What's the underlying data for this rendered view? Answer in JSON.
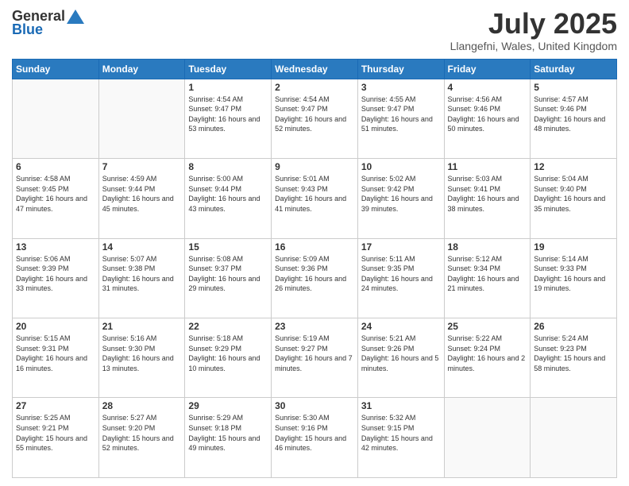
{
  "logo": {
    "general": "General",
    "blue": "Blue"
  },
  "header": {
    "month": "July 2025",
    "location": "Llangefni, Wales, United Kingdom"
  },
  "days_of_week": [
    "Sunday",
    "Monday",
    "Tuesday",
    "Wednesday",
    "Thursday",
    "Friday",
    "Saturday"
  ],
  "weeks": [
    [
      {
        "day": "",
        "sunrise": "",
        "sunset": "",
        "daylight": ""
      },
      {
        "day": "",
        "sunrise": "",
        "sunset": "",
        "daylight": ""
      },
      {
        "day": "1",
        "sunrise": "Sunrise: 4:54 AM",
        "sunset": "Sunset: 9:47 PM",
        "daylight": "Daylight: 16 hours and 53 minutes."
      },
      {
        "day": "2",
        "sunrise": "Sunrise: 4:54 AM",
        "sunset": "Sunset: 9:47 PM",
        "daylight": "Daylight: 16 hours and 52 minutes."
      },
      {
        "day": "3",
        "sunrise": "Sunrise: 4:55 AM",
        "sunset": "Sunset: 9:47 PM",
        "daylight": "Daylight: 16 hours and 51 minutes."
      },
      {
        "day": "4",
        "sunrise": "Sunrise: 4:56 AM",
        "sunset": "Sunset: 9:46 PM",
        "daylight": "Daylight: 16 hours and 50 minutes."
      },
      {
        "day": "5",
        "sunrise": "Sunrise: 4:57 AM",
        "sunset": "Sunset: 9:46 PM",
        "daylight": "Daylight: 16 hours and 48 minutes."
      }
    ],
    [
      {
        "day": "6",
        "sunrise": "Sunrise: 4:58 AM",
        "sunset": "Sunset: 9:45 PM",
        "daylight": "Daylight: 16 hours and 47 minutes."
      },
      {
        "day": "7",
        "sunrise": "Sunrise: 4:59 AM",
        "sunset": "Sunset: 9:44 PM",
        "daylight": "Daylight: 16 hours and 45 minutes."
      },
      {
        "day": "8",
        "sunrise": "Sunrise: 5:00 AM",
        "sunset": "Sunset: 9:44 PM",
        "daylight": "Daylight: 16 hours and 43 minutes."
      },
      {
        "day": "9",
        "sunrise": "Sunrise: 5:01 AM",
        "sunset": "Sunset: 9:43 PM",
        "daylight": "Daylight: 16 hours and 41 minutes."
      },
      {
        "day": "10",
        "sunrise": "Sunrise: 5:02 AM",
        "sunset": "Sunset: 9:42 PM",
        "daylight": "Daylight: 16 hours and 39 minutes."
      },
      {
        "day": "11",
        "sunrise": "Sunrise: 5:03 AM",
        "sunset": "Sunset: 9:41 PM",
        "daylight": "Daylight: 16 hours and 38 minutes."
      },
      {
        "day": "12",
        "sunrise": "Sunrise: 5:04 AM",
        "sunset": "Sunset: 9:40 PM",
        "daylight": "Daylight: 16 hours and 35 minutes."
      }
    ],
    [
      {
        "day": "13",
        "sunrise": "Sunrise: 5:06 AM",
        "sunset": "Sunset: 9:39 PM",
        "daylight": "Daylight: 16 hours and 33 minutes."
      },
      {
        "day": "14",
        "sunrise": "Sunrise: 5:07 AM",
        "sunset": "Sunset: 9:38 PM",
        "daylight": "Daylight: 16 hours and 31 minutes."
      },
      {
        "day": "15",
        "sunrise": "Sunrise: 5:08 AM",
        "sunset": "Sunset: 9:37 PM",
        "daylight": "Daylight: 16 hours and 29 minutes."
      },
      {
        "day": "16",
        "sunrise": "Sunrise: 5:09 AM",
        "sunset": "Sunset: 9:36 PM",
        "daylight": "Daylight: 16 hours and 26 minutes."
      },
      {
        "day": "17",
        "sunrise": "Sunrise: 5:11 AM",
        "sunset": "Sunset: 9:35 PM",
        "daylight": "Daylight: 16 hours and 24 minutes."
      },
      {
        "day": "18",
        "sunrise": "Sunrise: 5:12 AM",
        "sunset": "Sunset: 9:34 PM",
        "daylight": "Daylight: 16 hours and 21 minutes."
      },
      {
        "day": "19",
        "sunrise": "Sunrise: 5:14 AM",
        "sunset": "Sunset: 9:33 PM",
        "daylight": "Daylight: 16 hours and 19 minutes."
      }
    ],
    [
      {
        "day": "20",
        "sunrise": "Sunrise: 5:15 AM",
        "sunset": "Sunset: 9:31 PM",
        "daylight": "Daylight: 16 hours and 16 minutes."
      },
      {
        "day": "21",
        "sunrise": "Sunrise: 5:16 AM",
        "sunset": "Sunset: 9:30 PM",
        "daylight": "Daylight: 16 hours and 13 minutes."
      },
      {
        "day": "22",
        "sunrise": "Sunrise: 5:18 AM",
        "sunset": "Sunset: 9:29 PM",
        "daylight": "Daylight: 16 hours and 10 minutes."
      },
      {
        "day": "23",
        "sunrise": "Sunrise: 5:19 AM",
        "sunset": "Sunset: 9:27 PM",
        "daylight": "Daylight: 16 hours and 7 minutes."
      },
      {
        "day": "24",
        "sunrise": "Sunrise: 5:21 AM",
        "sunset": "Sunset: 9:26 PM",
        "daylight": "Daylight: 16 hours and 5 minutes."
      },
      {
        "day": "25",
        "sunrise": "Sunrise: 5:22 AM",
        "sunset": "Sunset: 9:24 PM",
        "daylight": "Daylight: 16 hours and 2 minutes."
      },
      {
        "day": "26",
        "sunrise": "Sunrise: 5:24 AM",
        "sunset": "Sunset: 9:23 PM",
        "daylight": "Daylight: 15 hours and 58 minutes."
      }
    ],
    [
      {
        "day": "27",
        "sunrise": "Sunrise: 5:25 AM",
        "sunset": "Sunset: 9:21 PM",
        "daylight": "Daylight: 15 hours and 55 minutes."
      },
      {
        "day": "28",
        "sunrise": "Sunrise: 5:27 AM",
        "sunset": "Sunset: 9:20 PM",
        "daylight": "Daylight: 15 hours and 52 minutes."
      },
      {
        "day": "29",
        "sunrise": "Sunrise: 5:29 AM",
        "sunset": "Sunset: 9:18 PM",
        "daylight": "Daylight: 15 hours and 49 minutes."
      },
      {
        "day": "30",
        "sunrise": "Sunrise: 5:30 AM",
        "sunset": "Sunset: 9:16 PM",
        "daylight": "Daylight: 15 hours and 46 minutes."
      },
      {
        "day": "31",
        "sunrise": "Sunrise: 5:32 AM",
        "sunset": "Sunset: 9:15 PM",
        "daylight": "Daylight: 15 hours and 42 minutes."
      },
      {
        "day": "",
        "sunrise": "",
        "sunset": "",
        "daylight": ""
      },
      {
        "day": "",
        "sunrise": "",
        "sunset": "",
        "daylight": ""
      }
    ]
  ]
}
